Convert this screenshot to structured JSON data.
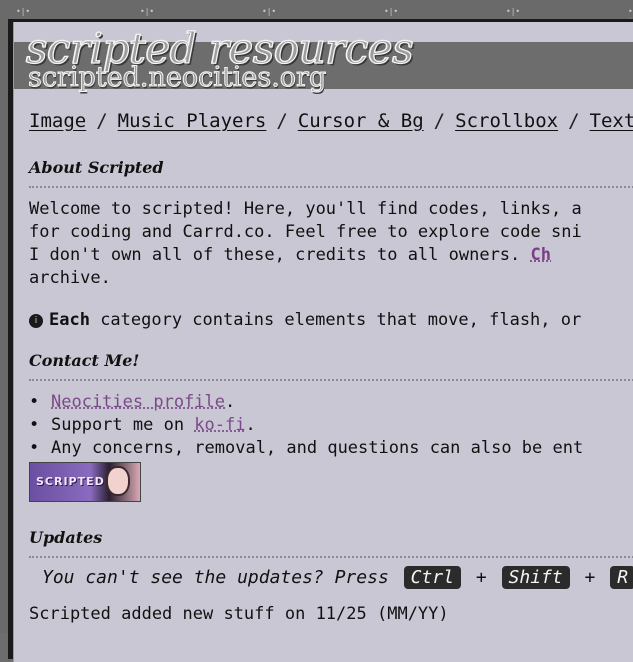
{
  "site": {
    "title": "scripted resources",
    "subtitle": "scripted.neocities.org"
  },
  "nav": [
    {
      "label": "Image"
    },
    {
      "label": "Music Players"
    },
    {
      "label": "Cursor & Bg"
    },
    {
      "label": "Scrollbox"
    },
    {
      "label": "Text"
    }
  ],
  "nav_separator": "/",
  "about": {
    "heading": "About Scripted",
    "line1": "Welcome to scripted! Here, you'll find codes, links, a",
    "line2": "for coding and Carrd.co. Feel free to explore code sni",
    "line3_prefix": "I don't own all of these, credits to all owners. ",
    "line3_link": "Ch",
    "line4": "archive.",
    "note_icon": "info-icon",
    "note_bold": "Each",
    "note_rest": " category contains elements that move, flash, or"
  },
  "contact": {
    "heading": "Contact Me!",
    "bullet": "•",
    "item1_link": "Neocities profile",
    "item1_suffix": ".",
    "item2_prefix": "Support me on ",
    "item2_link": "ko-fi",
    "item2_suffix": ".",
    "item3": "Any concerns, removal, and questions can also be ent",
    "badge_text": "SCRIPTED"
  },
  "updates": {
    "heading": "Updates",
    "hint_prefix": "You can't see the updates? Press",
    "key1": "Ctrl",
    "plus": "+",
    "key2": "Shift",
    "key3": "R",
    "latest": "Scripted added new stuff on 11/25 (MM/YY)"
  }
}
